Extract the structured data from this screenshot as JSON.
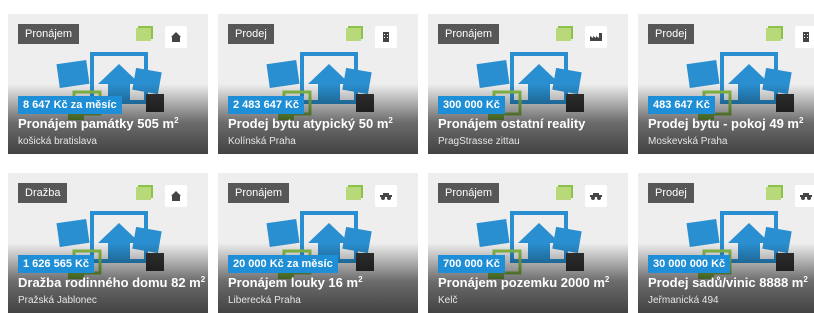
{
  "listings": [
    {
      "badge": "Pronájem",
      "price": "8 647 Kč za měsíc",
      "title": "Pronájem památky 505 m",
      "title_sup": "2",
      "location": "košická bratislava",
      "type_icon": "house-icon"
    },
    {
      "badge": "Prodej",
      "price": "2 483 647 Kč",
      "title": "Prodej bytu atypický 50 m",
      "title_sup": "2",
      "location": "Kolínská Praha",
      "type_icon": "building-icon"
    },
    {
      "badge": "Pronájem",
      "price": "300 000 Kč",
      "title": "Pronájem ostatní reality",
      "title_sup": "",
      "location": "PragStrasse zittau",
      "type_icon": "factory-icon"
    },
    {
      "badge": "Prodej",
      "price": "483 647 Kč",
      "title": "Prodej bytu - pokoj 49 m",
      "title_sup": "2",
      "location": "Moskevská Praha",
      "type_icon": "building-icon"
    },
    {
      "badge": "Dražba",
      "price": "1 626 565 Kč",
      "title": "Dražba rodinného domu 82 m",
      "title_sup": "2",
      "location": "Pražská Jablonec",
      "type_icon": "house-icon"
    },
    {
      "badge": "Pronájem",
      "price": "20 000 Kč za měsíc",
      "title": "Pronájem louky 16 m",
      "title_sup": "2",
      "location": "Liberecká Praha",
      "type_icon": "land-icon"
    },
    {
      "badge": "Pronájem",
      "price": "700 000 Kč",
      "title": "Pronájem pozemku 2000 m",
      "title_sup": "2",
      "location": "Kelč",
      "type_icon": "land-icon"
    },
    {
      "badge": "Prodej",
      "price": "30 000 000 Kč",
      "title": "Prodej sadů/vinic 8888 m",
      "title_sup": "2",
      "location": "Jeřmanická 494",
      "type_icon": "land-icon"
    }
  ],
  "colors": {
    "price_bg": "#1e8fd6",
    "badge_bg": "#575757",
    "illustration_blue": "#2a8fd0",
    "illustration_green": "#8bc34a"
  }
}
